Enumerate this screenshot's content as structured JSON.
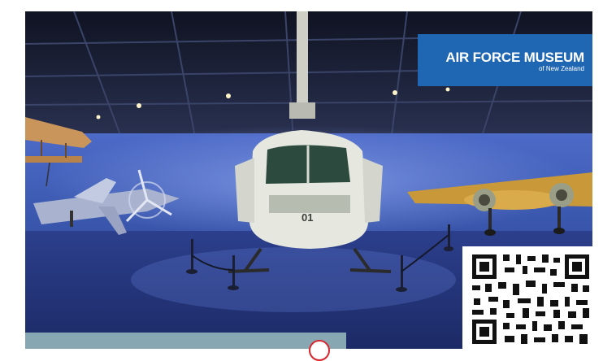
{
  "logo": {
    "main": "AIR FORCE MUSEUM",
    "sub": "of New Zealand"
  },
  "helicopter": {
    "tail_number": "01"
  },
  "colors": {
    "brand_blue": "#1f66b3",
    "hall_blue": "#3d5fb8",
    "caption_strip": "#87a8b3",
    "accent_red": "#d7262e"
  },
  "icons": [
    "qr-code-icon",
    "badge-circle-icon"
  ]
}
